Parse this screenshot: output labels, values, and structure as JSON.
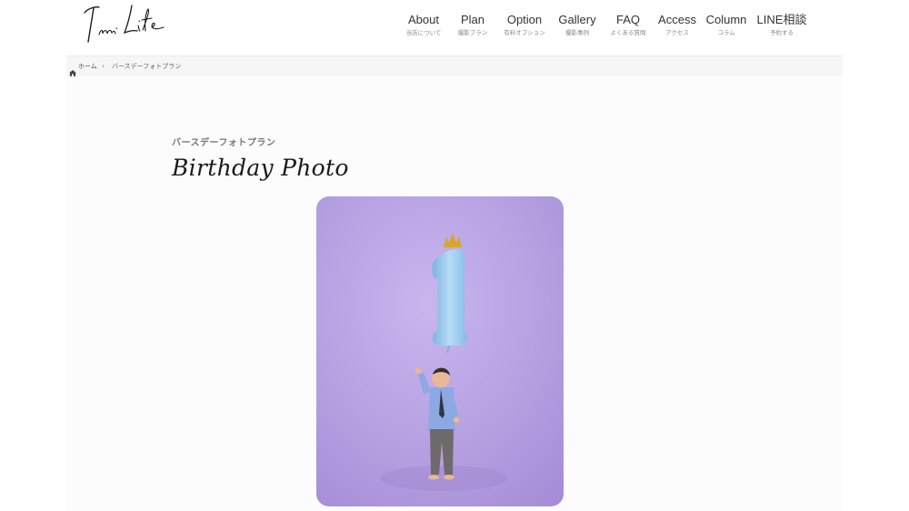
{
  "header": {
    "logo_text": "Inai Life",
    "nav": [
      {
        "en": "About",
        "jp": "当店について"
      },
      {
        "en": "Plan",
        "jp": "撮影プラン"
      },
      {
        "en": "Option",
        "jp": "有料オプション"
      },
      {
        "en": "Gallery",
        "jp": "撮影事例"
      },
      {
        "en": "FAQ",
        "jp": "よくある質問"
      },
      {
        "en": "Access",
        "jp": "アクセス"
      },
      {
        "en": "Column",
        "jp": "コラム"
      },
      {
        "en": "LINE相談",
        "jp": "予約する"
      }
    ]
  },
  "breadcrumb": {
    "home": "ホーム",
    "current": "バースデーフォトプラン"
  },
  "main": {
    "subtitle": "バースデーフォトプラン",
    "title": "Birthday Photo"
  },
  "colors": {
    "photo_background": "#b39ee0",
    "balloon": "#9cc8ec",
    "crown": "#d9a62a"
  },
  "icons": {
    "home": "home-icon",
    "separator": "chevron-right-icon"
  }
}
